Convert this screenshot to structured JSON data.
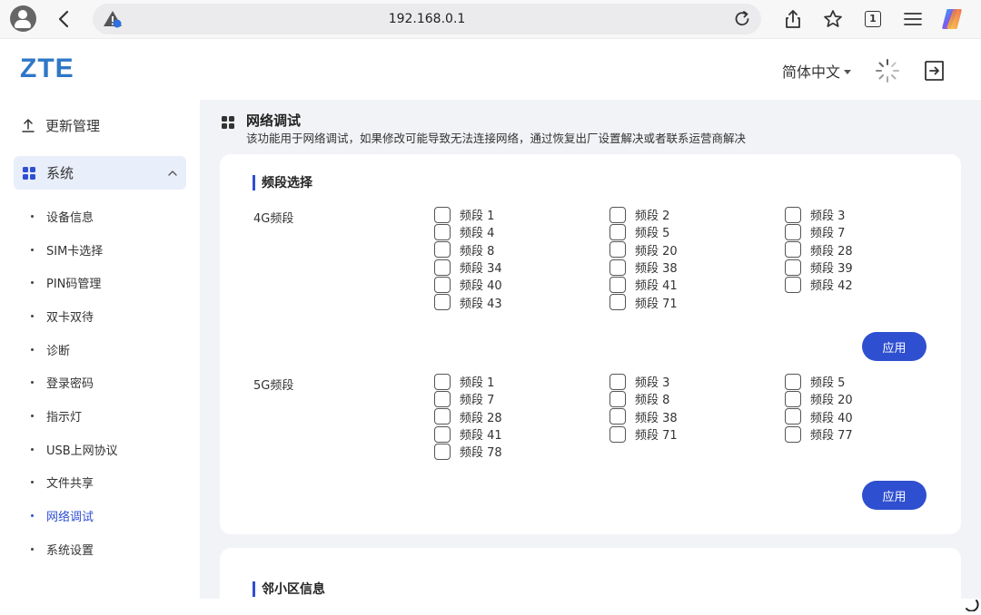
{
  "browser": {
    "url": "192.168.0.1",
    "tab_count": "1"
  },
  "header": {
    "logo": "ZTE",
    "language": "简体中文"
  },
  "sidebar": {
    "top_item": "更新管理",
    "group_label": "系统",
    "items": [
      {
        "label": "设备信息",
        "active": false
      },
      {
        "label": "SIM卡选择",
        "active": false
      },
      {
        "label": "PIN码管理",
        "active": false
      },
      {
        "label": "双卡双待",
        "active": false
      },
      {
        "label": "诊断",
        "active": false
      },
      {
        "label": "登录密码",
        "active": false
      },
      {
        "label": "指示灯",
        "active": false
      },
      {
        "label": "USB上网协议",
        "active": false
      },
      {
        "label": "文件共享",
        "active": false
      },
      {
        "label": "网络调试",
        "active": true
      },
      {
        "label": "系统设置",
        "active": false
      }
    ]
  },
  "page": {
    "title": "网络调试",
    "description": "该功能用于网络调试，如果修改可能导致无法连接网络，通过恢复出厂设置解决或者联系运营商解决"
  },
  "band_selection": {
    "title": "频段选择",
    "lte": {
      "label": "4G频段",
      "bands": [
        "频段 1",
        "频段 2",
        "频段 3",
        "频段 4",
        "频段 5",
        "频段 7",
        "频段 8",
        "频段 20",
        "频段 28",
        "频段 34",
        "频段 38",
        "频段 39",
        "频段 40",
        "频段 41",
        "频段 42",
        "频段 43",
        "频段 71"
      ],
      "apply_label": "应用"
    },
    "nr": {
      "label": "5G频段",
      "bands": [
        "频段 1",
        "频段 3",
        "频段 5",
        "频段 7",
        "频段 8",
        "频段 20",
        "频段 28",
        "频段 38",
        "频段 40",
        "频段 41",
        "频段 71",
        "频段 77",
        "频段 78"
      ],
      "apply_label": "应用"
    }
  },
  "neighbor": {
    "title": "邻小区信息"
  },
  "colors": {
    "accent": "#2f4fd1",
    "logo": "#2e77c8",
    "content_bg": "#f2f3f6"
  }
}
